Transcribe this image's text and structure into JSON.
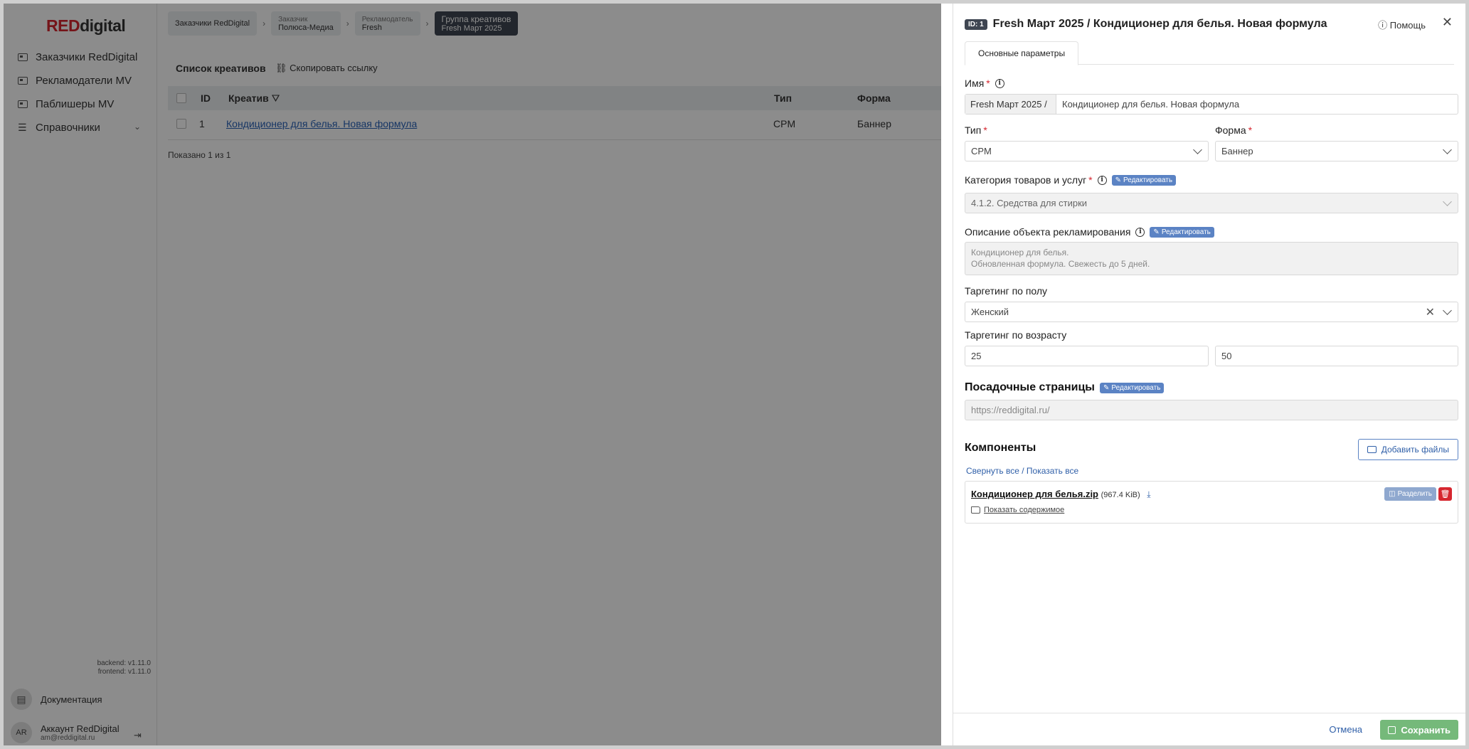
{
  "sidebar": {
    "logo_red": "RED",
    "logo_rest": "digital",
    "items": [
      {
        "label": "Заказчики RedDigital"
      },
      {
        "label": "Рекламодатели MV"
      },
      {
        "label": "Паблишеры MV"
      },
      {
        "label": "Справочники"
      }
    ],
    "version_backend": "backend: v1.11.0",
    "version_frontend": "frontend: v1.11.0",
    "docs_label": "Документация",
    "account_initials": "AR",
    "account_name": "Аккаунт RedDigital",
    "account_email": "am@reddigital.ru"
  },
  "breadcrumbs": [
    {
      "label": "Заказчики RedDigital",
      "sub": ""
    },
    {
      "label": "Заказчик",
      "sub": "Полюса-Медиа"
    },
    {
      "label": "Рекламодатель",
      "sub": "Fresh"
    },
    {
      "label": "Группа креативов",
      "sub": "Fresh Март 2025"
    }
  ],
  "list": {
    "title": "Список креативов",
    "copy_link": "Скопировать ссылку",
    "columns": [
      "ID",
      "Креатив",
      "Тип",
      "Форма"
    ],
    "rows": [
      {
        "id": "1",
        "creative": "Кондиционер для белья. Новая формула",
        "type": "CPM",
        "form": "Баннер"
      }
    ],
    "shown": "Показано 1 из 1"
  },
  "drawer": {
    "id_badge": "ID: 1",
    "title": "Fresh Март 2025 / Кондиционер для белья. Новая формула",
    "help": "Помощь",
    "tab": "Основные параметры",
    "name_label": "Имя",
    "name_prefix": "Fresh Март 2025 /",
    "name_value": "Кондиционер для белья. Новая формула",
    "type_label": "Тип",
    "type_value": "CPM",
    "form_label": "Форма",
    "form_value": "Баннер",
    "category_label": "Категория товаров и услуг",
    "category_value": "4.1.2. Средства для стирки",
    "edit_label": "Редактировать",
    "description_label": "Описание объекта рекламирования",
    "description_line1": "Кондиционер для белья.",
    "description_line2": "Обновленная формула. Свежесть до 5 дней.",
    "gender_label": "Таргетинг по полу",
    "gender_value": "Женский",
    "age_label": "Таргетинг по возрасту",
    "age_from": "25",
    "age_to": "50",
    "landing_label": "Посадочные страницы",
    "landing_value": "https://reddigital.ru/",
    "components_label": "Компоненты",
    "add_files": "Добавить файлы",
    "collapse_all": "Свернуть все",
    "slash": " / ",
    "show_all": "Показать все",
    "file_name": "Кондиционер для белья.zip",
    "file_size": "(967.4 KiB)",
    "show_content": "Показать содержимое",
    "split": "Разделить",
    "cancel": "Отмена",
    "save": "Сохранить"
  },
  "colors": {
    "brand_red": "#d6262f",
    "link_blue": "#2f5fa8",
    "badge_blue": "#5b83c4",
    "save_green": "#75b97a"
  }
}
